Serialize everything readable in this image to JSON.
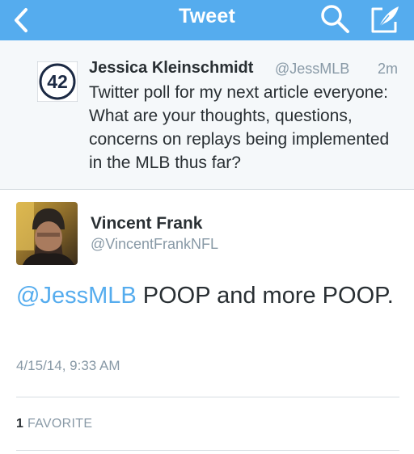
{
  "header": {
    "title": "Tweet",
    "icons": [
      "back-chevron-icon",
      "search-icon",
      "compose-icon"
    ],
    "color": "#55acee"
  },
  "parent_tweet": {
    "avatar_text": "42",
    "name": "Jessica Kleinschmidt",
    "handle": "@JessMLB",
    "time": "2m",
    "text": "Twitter poll for my next article everyone: What are your thoughts, questions, concerns on replays being implemented in the MLB thus far?"
  },
  "main_tweet": {
    "name": "Vincent Frank",
    "handle": "@VincentFrankNFL",
    "mention": "@JessMLB",
    "text": " POOP and more POOP.",
    "timestamp": "4/15/14, 9:33 AM",
    "favorites_count": "1",
    "favorites_label": "FAVORITE"
  }
}
